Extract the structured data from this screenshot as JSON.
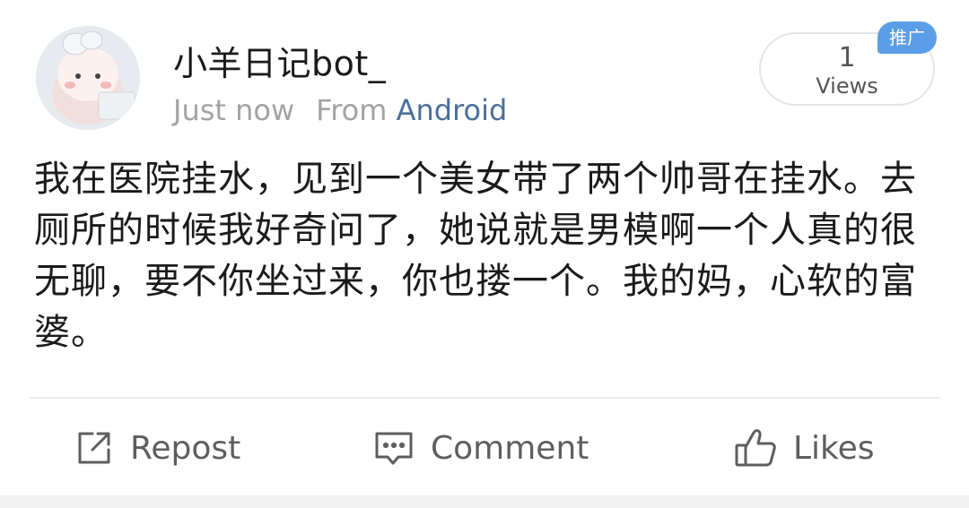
{
  "post": {
    "username": "小羊日记bot_",
    "time": "Just now",
    "source_prefix": "From",
    "source": "Android",
    "views_count": "1",
    "views_label": "Views",
    "promo_badge": "推广",
    "text": "我在医院挂水，见到一个美女带了两个帅哥在挂水。去厕所的时候我好奇问了，她说就是男模啊一个人真的很无聊，要不你坐过来，你也搂一个。我的妈，心软的富婆。"
  },
  "actions": {
    "repost": "Repost",
    "comment": "Comment",
    "likes": "Likes"
  },
  "icons": {
    "repost": "share-box-arrow-icon",
    "comment": "comment-bubble-icon",
    "likes": "thumbs-up-icon"
  },
  "colors": {
    "link": "#4a6f9a",
    "badge": "#5b9ee8",
    "muted": "#a3a3a3"
  }
}
